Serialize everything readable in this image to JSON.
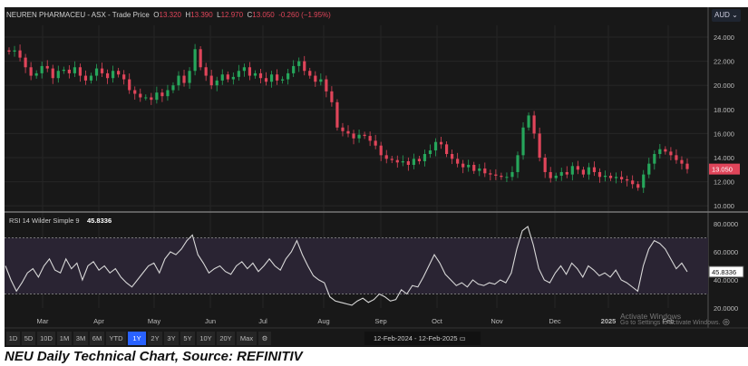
{
  "header": {
    "symbol": "NEUREN PHARMACEU - ASX - Trade Price",
    "o_label": "O",
    "o": "13.320",
    "h_label": "H",
    "h": "13.390",
    "l_label": "L",
    "l": "12.970",
    "c_label": "C",
    "c": "13.050",
    "change": "-0.260 (−1.95%)",
    "currency": "AUD ⌄"
  },
  "rsi_label": "RSI 14 Wilder Simple 9",
  "rsi_value": "45.8336",
  "buttons": [
    "1D",
    "5D",
    "10D",
    "1M",
    "3M",
    "6M",
    "YTD",
    "1Y",
    "2Y",
    "3Y",
    "5Y",
    "10Y",
    "20Y",
    "Max"
  ],
  "active_button": "1Y",
  "date_range": "12-Feb-2024  -  12-Feb-2025",
  "watermark": {
    "line1": "Activate Windows",
    "line2": "Go to Settings to activate Windows."
  },
  "caption": "NEU Daily Technical Chart, Source: REFINITIV",
  "colors": {
    "up": "#26a65b",
    "down": "#e0455a",
    "rsi": "#d8d8d8",
    "band": "#2a2433"
  },
  "chart_data": [
    {
      "type": "candlestick",
      "title": "NEUREN PHARMACEU - ASX - Trade Price",
      "ylabel": "AUD",
      "ylim": [
        10,
        25
      ],
      "yticks": [
        "24.000",
        "22.000",
        "20.000",
        "18.000",
        "16.000",
        "14.000",
        "12.000",
        "10.000"
      ],
      "last_price": "13.050",
      "xticks": [
        "Mar",
        "Apr",
        "May",
        "Jun",
        "Jul",
        "Aug",
        "Sep",
        "Oct",
        "Nov",
        "Dec",
        "2025",
        "Feb"
      ],
      "closes": [
        22.8,
        22.9,
        22.3,
        21.5,
        20.8,
        21.0,
        21.6,
        21.4,
        20.6,
        21.2,
        21.3,
        21.0,
        21.5,
        20.8,
        20.4,
        20.8,
        21.4,
        21.0,
        20.6,
        21.2,
        20.9,
        20.5,
        19.6,
        19.3,
        19.0,
        19.0,
        18.8,
        19.4,
        19.1,
        19.6,
        20.0,
        20.8,
        20.2,
        21.2,
        23.0,
        21.5,
        20.8,
        20.0,
        20.4,
        20.9,
        20.5,
        20.7,
        21.2,
        21.5,
        20.8,
        21.0,
        20.6,
        20.3,
        20.9,
        20.4,
        20.5,
        21.0,
        21.6,
        22.0,
        21.2,
        20.8,
        20.3,
        20.5,
        19.5,
        18.6,
        16.5,
        16.2,
        16.0,
        15.6,
        15.9,
        15.8,
        15.4,
        15.0,
        14.2,
        13.9,
        13.8,
        13.6,
        13.7,
        13.4,
        13.9,
        13.7,
        14.3,
        14.6,
        15.3,
        15.1,
        14.3,
        13.9,
        13.5,
        13.2,
        13.4,
        12.9,
        13.1,
        12.7,
        12.6,
        12.5,
        12.4,
        12.4,
        12.8,
        14.2,
        16.5,
        17.5,
        16.0,
        14.0,
        12.8,
        12.3,
        12.5,
        12.8,
        12.6,
        13.3,
        13.0,
        12.6,
        13.2,
        12.8,
        12.4,
        12.5,
        12.3,
        12.4,
        12.2,
        12.1,
        11.8,
        11.5,
        12.6,
        13.5,
        14.3,
        14.7,
        14.5,
        14.2,
        13.8,
        13.5,
        13.05
      ]
    },
    {
      "type": "line",
      "title": "RSI 14 Wilder Simple 9",
      "ylim": [
        15,
        85
      ],
      "bands": [
        30,
        70
      ],
      "yticks": [
        "80.0000",
        "60.0000",
        "40.0000",
        "20.0000"
      ],
      "last_value": "45.8336",
      "values": [
        50,
        40,
        32,
        38,
        45,
        48,
        42,
        50,
        55,
        47,
        45,
        55,
        48,
        52,
        40,
        50,
        53,
        47,
        50,
        45,
        48,
        42,
        38,
        35,
        40,
        45,
        50,
        52,
        45,
        55,
        60,
        58,
        62,
        68,
        72,
        58,
        52,
        45,
        48,
        50,
        46,
        44,
        50,
        53,
        48,
        52,
        46,
        50,
        55,
        50,
        47,
        55,
        60,
        68,
        58,
        50,
        43,
        40,
        38,
        28,
        25,
        24,
        23,
        22,
        25,
        27,
        24,
        26,
        30,
        28,
        25,
        26,
        33,
        30,
        36,
        35,
        42,
        50,
        58,
        52,
        44,
        40,
        36,
        38,
        35,
        40,
        37,
        36,
        38,
        37,
        40,
        38,
        45,
        62,
        75,
        78,
        65,
        48,
        40,
        38,
        45,
        50,
        44,
        52,
        48,
        42,
        50,
        47,
        43,
        45,
        42,
        47,
        40,
        38,
        35,
        32,
        50,
        62,
        68,
        66,
        62,
        55,
        48,
        52,
        45.83
      ]
    }
  ]
}
